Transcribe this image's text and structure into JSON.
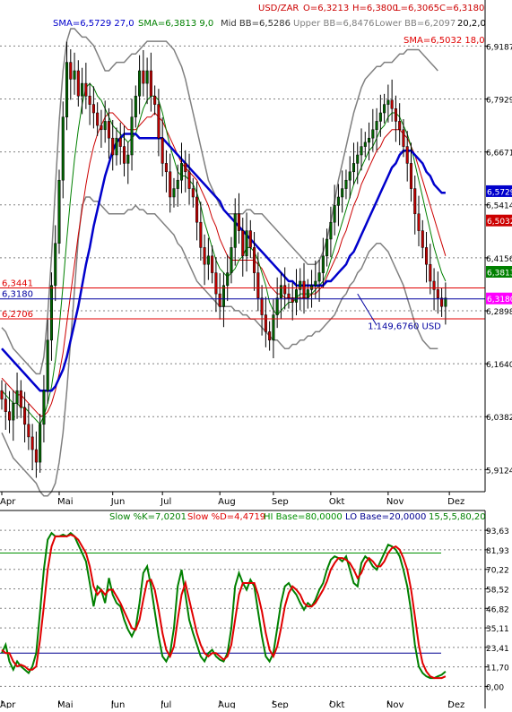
{
  "colors": {
    "price_up": "#006400",
    "price_down": "#c00000",
    "sma_fast": "#008000",
    "sma_mid": "#cc0000",
    "sma_slow": "#0000cc",
    "bollinger": "#808080",
    "hline_red": "#e00000",
    "hline_blue": "#0000a0",
    "stoch_k": "#008000",
    "stoch_d": "#e00000",
    "stoch_hi": "#009000",
    "stoch_lo": "#000090",
    "last_price_tag": "#ff00ff",
    "grid": "#808080"
  },
  "chart_data": [
    {
      "type": "candlestick",
      "symbol": "USD/ZAR",
      "ohlc_text": {
        "symbol": "USD/ZAR",
        "o": "O=6,3213",
        "h": "H=6,3800",
        "l": "L=6,3065",
        "c": "C=6,3180"
      },
      "indicator_text": {
        "sma_a": "SMA=6,5729 27,0",
        "sma_b": "SMA=6,3813 9,0",
        "mid_bb": "Mid BB=6,5286",
        "upper_bb": "Upper BB=6,8476",
        "lower_bb": "Lower BB=6,2097",
        "bb_params": "20,2,0",
        "sma_c": "SMA=6,5032 18,0"
      },
      "ylim": [
        5.86,
        6.96
      ],
      "yticks": [
        "6,9187",
        "6,7929",
        "6,6671",
        "6,5414",
        "6,4156",
        "6,2898",
        "6,1640",
        "6,0382",
        "5,9124"
      ],
      "ytick_values": [
        6.9187,
        6.7929,
        6.6671,
        6.5414,
        6.4156,
        6.2898,
        6.164,
        6.0382,
        5.9124
      ],
      "price_tags": [
        {
          "text": "6,5729",
          "value": 6.5729,
          "role": "sma_slow"
        },
        {
          "text": "6,5032",
          "value": 6.5032,
          "role": "sma_mid"
        },
        {
          "text": "6,3813",
          "value": 6.3813,
          "role": "sma_fast"
        },
        {
          "text": "6,3180",
          "value": 6.318,
          "role": "last"
        }
      ],
      "hlines": [
        {
          "label": "6,3441",
          "value": 6.3441,
          "color": "hline_red"
        },
        {
          "label": "6,3180",
          "value": 6.318,
          "color": "hline_blue"
        },
        {
          "label": "6,2706",
          "value": 6.2706,
          "color": "hline_red"
        }
      ],
      "annotation": {
        "text": "1.149,6760 USD",
        "x": 98,
        "y": 6.255,
        "arrow_from_x": 98,
        "arrow_from_y": 6.255,
        "arrow_to_x": 93,
        "arrow_to_y": 6.33
      },
      "xlabels": [
        {
          "text": "Apr",
          "x": 0
        },
        {
          "text": "Mai",
          "x": 15
        },
        {
          "text": "Jun",
          "x": 29
        },
        {
          "text": "Jul",
          "x": 42
        },
        {
          "text": "Aug",
          "x": 57
        },
        {
          "text": "Sep",
          "x": 71
        },
        {
          "text": "Okt",
          "x": 86
        },
        {
          "text": "Nov",
          "x": 101
        },
        {
          "text": "Dez",
          "x": 117
        }
      ],
      "x_range": [
        0,
        124
      ],
      "close": [
        6.08,
        6.05,
        6.03,
        6.07,
        6.1,
        6.06,
        6.02,
        5.99,
        5.96,
        5.93,
        6.02,
        6.1,
        6.22,
        6.35,
        6.45,
        6.6,
        6.75,
        6.88,
        6.84,
        6.86,
        6.8,
        6.83,
        6.8,
        6.78,
        6.76,
        6.73,
        6.72,
        6.74,
        6.7,
        6.66,
        6.7,
        6.68,
        6.64,
        6.66,
        6.75,
        6.8,
        6.86,
        6.83,
        6.86,
        6.8,
        6.78,
        6.7,
        6.64,
        6.62,
        6.56,
        6.58,
        6.6,
        6.64,
        6.62,
        6.58,
        6.56,
        6.5,
        6.44,
        6.4,
        6.42,
        6.38,
        6.33,
        6.3,
        6.35,
        6.38,
        6.44,
        6.52,
        6.48,
        6.42,
        6.48,
        6.44,
        6.38,
        6.32,
        6.28,
        6.24,
        6.22,
        6.28,
        6.32,
        6.35,
        6.33,
        6.32,
        6.31,
        6.34,
        6.36,
        6.32,
        6.34,
        6.35,
        6.36,
        6.38,
        6.42,
        6.46,
        6.5,
        6.54,
        6.56,
        6.58,
        6.6,
        6.62,
        6.64,
        6.66,
        6.68,
        6.69,
        6.7,
        6.72,
        6.74,
        6.76,
        6.78,
        6.79,
        6.77,
        6.74,
        6.72,
        6.68,
        6.64,
        6.58,
        6.52,
        6.48,
        6.44,
        6.4,
        6.36,
        6.34,
        6.32,
        6.3,
        6.32
      ],
      "sma_fast": [
        6.1,
        6.09,
        6.08,
        6.07,
        6.07,
        6.06,
        6.06,
        6.05,
        6.04,
        6.03,
        6.02,
        6.04,
        6.07,
        6.11,
        6.17,
        6.25,
        6.35,
        6.46,
        6.56,
        6.65,
        6.72,
        6.78,
        6.82,
        6.83,
        6.82,
        6.8,
        6.79,
        6.77,
        6.75,
        6.73,
        6.72,
        6.71,
        6.7,
        6.69,
        6.7,
        6.71,
        6.74,
        6.77,
        6.79,
        6.8,
        6.8,
        6.79,
        6.76,
        6.72,
        6.68,
        6.65,
        6.62,
        6.61,
        6.61,
        6.6,
        6.59,
        6.57,
        6.54,
        6.5,
        6.47,
        6.44,
        6.41,
        6.39,
        6.38,
        6.37,
        6.38,
        6.39,
        6.41,
        6.42,
        6.44,
        6.44,
        6.43,
        6.41,
        6.38,
        6.35,
        6.31,
        6.29,
        6.28,
        6.29,
        6.3,
        6.31,
        6.31,
        6.32,
        6.33,
        6.33,
        6.33,
        6.33,
        6.34,
        6.35,
        6.36,
        6.38,
        6.41,
        6.44,
        6.47,
        6.5,
        6.53,
        6.56,
        6.59,
        6.61,
        6.63,
        6.65,
        6.67,
        6.68,
        6.7,
        6.72,
        6.73,
        6.75,
        6.76,
        6.76,
        6.75,
        6.73,
        6.71,
        6.68,
        6.64,
        6.6,
        6.56,
        6.52,
        6.48,
        6.44,
        6.41,
        6.38,
        6.36
      ],
      "sma_mid": [
        6.13,
        6.12,
        6.11,
        6.1,
        6.09,
        6.09,
        6.08,
        6.07,
        6.06,
        6.05,
        6.04,
        6.04,
        6.05,
        6.07,
        6.1,
        6.14,
        6.19,
        6.26,
        6.33,
        6.4,
        6.47,
        6.53,
        6.59,
        6.64,
        6.68,
        6.71,
        6.73,
        6.75,
        6.76,
        6.76,
        6.75,
        6.74,
        6.73,
        6.72,
        6.72,
        6.72,
        6.73,
        6.74,
        6.75,
        6.75,
        6.76,
        6.75,
        6.74,
        6.72,
        6.7,
        6.68,
        6.66,
        6.64,
        6.63,
        6.62,
        6.61,
        6.6,
        6.58,
        6.56,
        6.54,
        6.51,
        6.49,
        6.46,
        6.44,
        6.42,
        6.41,
        6.41,
        6.41,
        6.41,
        6.41,
        6.41,
        6.41,
        6.4,
        6.39,
        6.37,
        6.35,
        6.34,
        6.33,
        6.33,
        6.32,
        6.32,
        6.32,
        6.32,
        6.32,
        6.32,
        6.32,
        6.33,
        6.33,
        6.34,
        6.35,
        6.37,
        6.39,
        6.41,
        6.43,
        6.46,
        6.48,
        6.51,
        6.54,
        6.56,
        6.59,
        6.61,
        6.63,
        6.65,
        6.67,
        6.68,
        6.7,
        6.71,
        6.72,
        6.72,
        6.72,
        6.71,
        6.7,
        6.68,
        6.66,
        6.63,
        6.6,
        6.57,
        6.54,
        6.51,
        6.48,
        6.45,
        6.42
      ],
      "sma_slow": [
        6.2,
        6.19,
        6.18,
        6.17,
        6.16,
        6.15,
        6.14,
        6.13,
        6.12,
        6.11,
        6.1,
        6.1,
        6.1,
        6.1,
        6.11,
        6.13,
        6.15,
        6.18,
        6.22,
        6.26,
        6.3,
        6.35,
        6.4,
        6.44,
        6.49,
        6.53,
        6.57,
        6.61,
        6.64,
        6.67,
        6.69,
        6.7,
        6.71,
        6.71,
        6.71,
        6.71,
        6.7,
        6.7,
        6.7,
        6.7,
        6.7,
        6.7,
        6.7,
        6.69,
        6.68,
        6.67,
        6.66,
        6.65,
        6.64,
        6.63,
        6.62,
        6.61,
        6.6,
        6.59,
        6.58,
        6.57,
        6.56,
        6.55,
        6.53,
        6.52,
        6.51,
        6.5,
        6.49,
        6.48,
        6.47,
        6.46,
        6.45,
        6.44,
        6.43,
        6.42,
        6.41,
        6.4,
        6.39,
        6.38,
        6.37,
        6.36,
        6.36,
        6.35,
        6.35,
        6.35,
        6.35,
        6.35,
        6.35,
        6.35,
        6.35,
        6.36,
        6.36,
        6.37,
        6.38,
        6.39,
        6.4,
        6.42,
        6.43,
        6.45,
        6.47,
        6.49,
        6.51,
        6.53,
        6.55,
        6.57,
        6.59,
        6.61,
        6.63,
        6.64,
        6.66,
        6.67,
        6.67,
        6.67,
        6.66,
        6.65,
        6.64,
        6.62,
        6.61,
        6.59,
        6.58,
        6.57,
        6.57
      ],
      "bb_upper": [
        6.25,
        6.24,
        6.22,
        6.2,
        6.19,
        6.18,
        6.17,
        6.16,
        6.15,
        6.14,
        6.14,
        6.18,
        6.28,
        6.42,
        6.58,
        6.74,
        6.86,
        6.93,
        6.96,
        6.96,
        6.95,
        6.94,
        6.94,
        6.93,
        6.92,
        6.9,
        6.88,
        6.86,
        6.86,
        6.87,
        6.88,
        6.88,
        6.88,
        6.89,
        6.9,
        6.9,
        6.91,
        6.92,
        6.93,
        6.93,
        6.93,
        6.93,
        6.93,
        6.93,
        6.92,
        6.91,
        6.89,
        6.87,
        6.84,
        6.8,
        6.76,
        6.72,
        6.68,
        6.64,
        6.6,
        6.58,
        6.56,
        6.54,
        6.53,
        6.52,
        6.52,
        6.52,
        6.52,
        6.52,
        6.53,
        6.53,
        6.52,
        6.52,
        6.52,
        6.51,
        6.5,
        6.49,
        6.48,
        6.47,
        6.46,
        6.45,
        6.44,
        6.43,
        6.42,
        6.41,
        6.4,
        6.4,
        6.4,
        6.41,
        6.43,
        6.46,
        6.5,
        6.55,
        6.6,
        6.64,
        6.68,
        6.72,
        6.76,
        6.79,
        6.82,
        6.84,
        6.85,
        6.86,
        6.87,
        6.87,
        6.88,
        6.88,
        6.88,
        6.89,
        6.9,
        6.9,
        6.91,
        6.91,
        6.91,
        6.91,
        6.9,
        6.89,
        6.88,
        6.87,
        6.86
      ],
      "bb_lower": [
        6.0,
        5.98,
        5.96,
        5.94,
        5.93,
        5.92,
        5.91,
        5.9,
        5.89,
        5.88,
        5.86,
        5.85,
        5.85,
        5.86,
        5.88,
        5.93,
        6.0,
        6.1,
        6.22,
        6.34,
        6.46,
        6.54,
        6.56,
        6.56,
        6.55,
        6.55,
        6.54,
        6.53,
        6.52,
        6.52,
        6.52,
        6.52,
        6.52,
        6.53,
        6.53,
        6.54,
        6.53,
        6.53,
        6.52,
        6.52,
        6.52,
        6.51,
        6.5,
        6.49,
        6.48,
        6.47,
        6.45,
        6.44,
        6.42,
        6.4,
        6.38,
        6.36,
        6.35,
        6.34,
        6.33,
        6.32,
        6.31,
        6.3,
        6.3,
        6.3,
        6.3,
        6.29,
        6.29,
        6.28,
        6.28,
        6.27,
        6.27,
        6.26,
        6.25,
        6.24,
        6.23,
        6.22,
        6.22,
        6.21,
        6.2,
        6.2,
        6.21,
        6.21,
        6.22,
        6.22,
        6.23,
        6.23,
        6.24,
        6.24,
        6.25,
        6.26,
        6.27,
        6.28,
        6.3,
        6.32,
        6.33,
        6.35,
        6.36,
        6.38,
        6.39,
        6.41,
        6.43,
        6.44,
        6.45,
        6.45,
        6.44,
        6.43,
        6.41,
        6.39,
        6.37,
        6.35,
        6.32,
        6.29,
        6.26,
        6.24,
        6.22,
        6.21,
        6.2,
        6.2,
        6.2
      ]
    },
    {
      "type": "line",
      "title_parts": {
        "k": "Slow %K=7,0201",
        "d": "Slow %D=4,4719",
        "hi": "HI Base=80,0000",
        "lo": "LO Base=20,0000",
        "params": "15,5,5,80,20"
      },
      "ylim": [
        -3,
        98
      ],
      "yticks": [
        "93,63",
        "81,93",
        "70,22",
        "58,52",
        "46,82",
        "35,11",
        "23,41",
        "11,70",
        "0,00"
      ],
      "ytick_values": [
        93.63,
        81.93,
        70.22,
        58.52,
        46.82,
        35.11,
        23.41,
        11.7,
        0
      ],
      "hi_base": 80,
      "lo_base": 20,
      "xlabels": [
        {
          "text": "Apr",
          "x": 0
        },
        {
          "text": "Mai",
          "x": 15
        },
        {
          "text": "Jun",
          "x": 29
        },
        {
          "text": "Jul",
          "x": 42
        },
        {
          "text": "Aug",
          "x": 57
        },
        {
          "text": "Sep",
          "x": 71
        },
        {
          "text": "Okt",
          "x": 86
        },
        {
          "text": "Nov",
          "x": 101
        },
        {
          "text": "Dez",
          "x": 117
        }
      ],
      "x_range": [
        0,
        124
      ],
      "series": [
        {
          "key": "k",
          "values": [
            20,
            25,
            15,
            10,
            15,
            12,
            10,
            8,
            12,
            20,
            45,
            70,
            88,
            92,
            90,
            90,
            91,
            90,
            92,
            90,
            85,
            80,
            75,
            62,
            48,
            60,
            58,
            50,
            65,
            55,
            50,
            48,
            40,
            34,
            30,
            35,
            50,
            68,
            72,
            60,
            45,
            30,
            18,
            15,
            20,
            35,
            60,
            70,
            55,
            40,
            32,
            25,
            18,
            15,
            20,
            22,
            18,
            16,
            15,
            20,
            35,
            60,
            68,
            62,
            58,
            64,
            60,
            45,
            30,
            18,
            15,
            20,
            35,
            50,
            60,
            62,
            58,
            55,
            50,
            46,
            50,
            48,
            52,
            58,
            62,
            70,
            76,
            78,
            77,
            75,
            78,
            70,
            62,
            60,
            74,
            78,
            76,
            72,
            70,
            75,
            80,
            85,
            84,
            82,
            78,
            70,
            60,
            45,
            25,
            12,
            8,
            6,
            5,
            5,
            6,
            7,
            9
          ]
        },
        {
          "key": "d",
          "values": [
            22,
            20,
            20,
            15,
            12,
            13,
            12,
            10,
            10,
            12,
            28,
            48,
            70,
            84,
            90,
            90,
            90,
            90,
            91,
            90,
            88,
            84,
            80,
            72,
            60,
            55,
            58,
            55,
            58,
            58,
            54,
            50,
            45,
            40,
            35,
            34,
            40,
            52,
            63,
            64,
            58,
            46,
            32,
            22,
            18,
            24,
            40,
            55,
            62,
            52,
            42,
            32,
            25,
            20,
            18,
            20,
            20,
            18,
            16,
            18,
            25,
            40,
            55,
            62,
            62,
            62,
            62,
            55,
            45,
            32,
            22,
            18,
            24,
            35,
            48,
            56,
            60,
            58,
            55,
            50,
            48,
            48,
            50,
            54,
            58,
            63,
            70,
            74,
            77,
            77,
            76,
            74,
            70,
            65,
            68,
            74,
            77,
            75,
            72,
            72,
            75,
            80,
            83,
            84,
            82,
            77,
            70,
            58,
            42,
            25,
            14,
            9,
            6,
            5,
            5,
            5,
            6
          ]
        }
      ]
    }
  ]
}
